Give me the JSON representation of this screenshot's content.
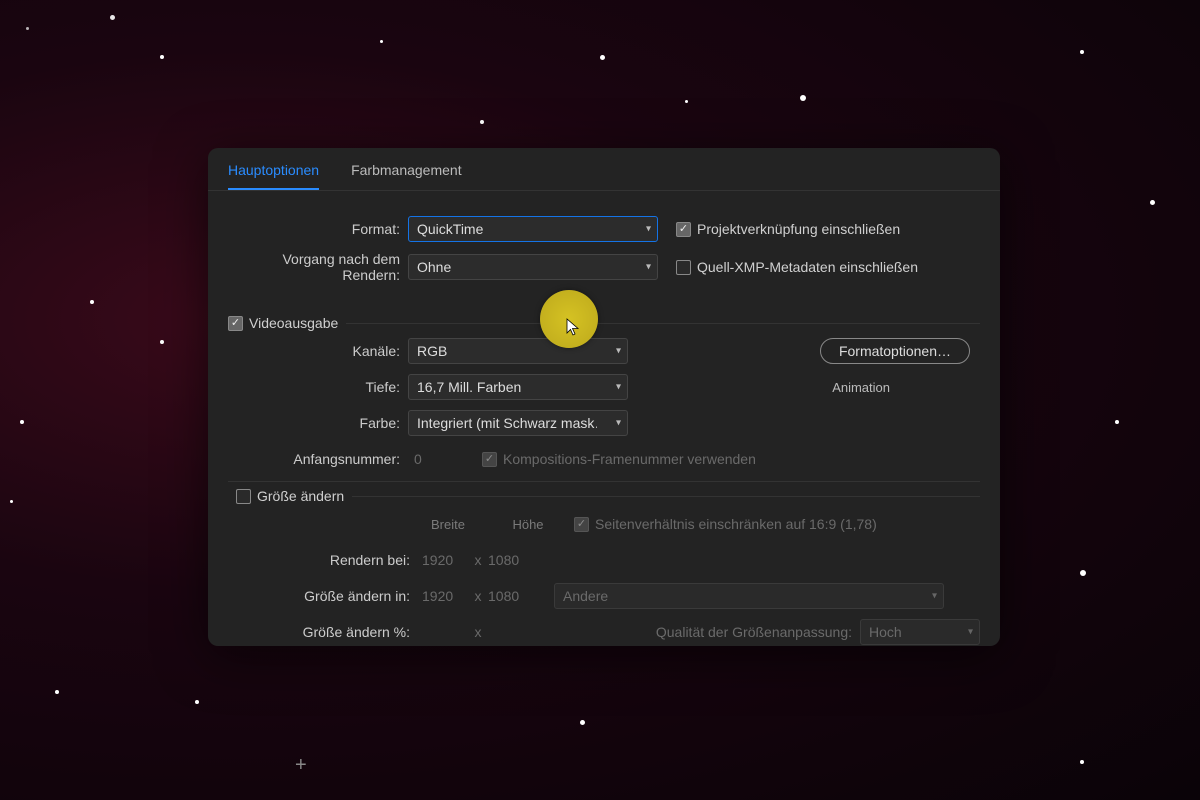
{
  "tabs": {
    "main": "Hauptoptionen",
    "color": "Farbmanagement"
  },
  "format": {
    "label": "Format:",
    "value": "QuickTime"
  },
  "postRender": {
    "label": "Vorgang nach dem Rendern:",
    "value": "Ohne"
  },
  "includeProjectLink": "Projektverknüpfung einschließen",
  "includeXmp": "Quell-XMP-Metadaten einschließen",
  "videoOutput": "Videoausgabe",
  "channels": {
    "label": "Kanäle:",
    "value": "RGB"
  },
  "depth": {
    "label": "Tiefe:",
    "value": "16,7 Mill. Farben"
  },
  "color": {
    "label": "Farbe:",
    "value": "Integriert (mit Schwarz mask…"
  },
  "startFrame": {
    "label": "Anfangsnummer:",
    "value": "0"
  },
  "useCompFrame": "Kompositions-Framenummer verwenden",
  "formatOptionsBtn": "Formatoptionen…",
  "codec": "Animation",
  "resize": {
    "title": "Größe ändern",
    "widthHeader": "Breite",
    "heightHeader": "Höhe",
    "lockAspect": "Seitenverhältnis einschränken auf 16:9 (1,78)",
    "renderAt": {
      "label": "Rendern bei:",
      "w": "1920",
      "h": "1080"
    },
    "resizeTo": {
      "label": "Größe ändern in:",
      "w": "1920",
      "h": "1080",
      "preset": "Andere"
    },
    "resizePct": {
      "label": "Größe ändern %:"
    },
    "qualityLabel": "Qualität der Größenanpassung:",
    "qualityValue": "Hoch",
    "x": "x"
  }
}
